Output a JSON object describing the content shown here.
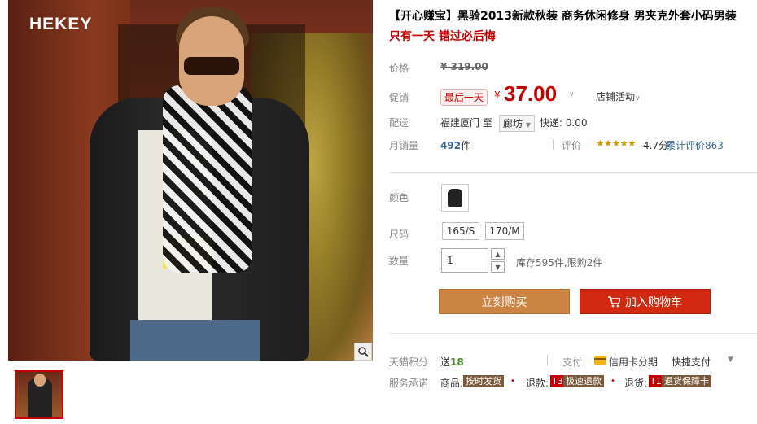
{
  "product": {
    "brand_logo": "HEKEY",
    "title": "【开心赚宝】黑骑2013新款秋装 商务休闲修身 男夹克外套小码男装",
    "subtitle": "只有一天 错过必后悔"
  },
  "pricing": {
    "price_label": "价格",
    "original_price": "¥ 319.00",
    "promo_label": "促销",
    "promo_tag": "最后一天",
    "currency_symbol": "¥",
    "sale_price": "37.00",
    "store_activity": "店铺活动"
  },
  "shipping": {
    "label": "配送",
    "from": "福建厦门 至",
    "to": "廊坊",
    "fee": "快递: 0.00"
  },
  "sales": {
    "label": "月销量",
    "count": "492",
    "unit": "件",
    "rating_label": "评价",
    "stars": "★★★★★",
    "score": "4.7分",
    "review_link": "累计评价863"
  },
  "options": {
    "color_label": "颜色",
    "size_label": "尺码",
    "sizes": [
      "165/S",
      "170/M"
    ],
    "qty_label": "数量",
    "qty_value": "1",
    "stock_text": "库存595件,限购2件"
  },
  "actions": {
    "buy_now": "立刻购买",
    "add_to_cart": "加入购物车"
  },
  "extras": {
    "points_label": "天猫积分",
    "points_prefix": "送",
    "points_value": "18",
    "pay_label": "支付",
    "credit_installment": "信用卡分期",
    "quick_pay": "快捷支付",
    "service_label": "服务承诺",
    "goods_label": "商品:",
    "goods_tag": "按时发货",
    "refund_label": "退款:",
    "refund_code": "T3",
    "refund_tag": "极速退款",
    "return_label": "退货:",
    "return_code": "T1",
    "return_tag": "退货保障卡"
  },
  "colors": {
    "accent_red": "#c40000",
    "buy_now_bg": "#cc8443",
    "add_cart_bg": "#d12a10"
  }
}
